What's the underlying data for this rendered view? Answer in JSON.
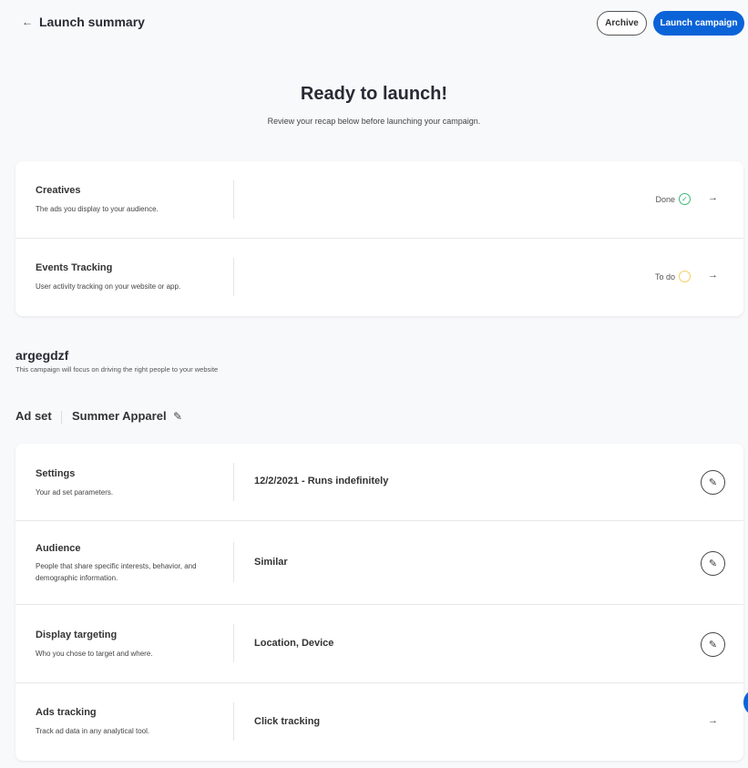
{
  "header": {
    "title": "Launch summary",
    "archive_label": "Archive",
    "launch_label": "Launch campaign"
  },
  "hero": {
    "title": "Ready to launch!",
    "subtitle": "Review your recap below before launching your campaign."
  },
  "checklist": [
    {
      "title": "Creatives",
      "desc": "The ads you display to your audience.",
      "status": "Done",
      "status_color": "#3cb878"
    },
    {
      "title": "Events Tracking",
      "desc": "User activity tracking on your website or app.",
      "status": "To do",
      "status_color": "#f5cf5a"
    }
  ],
  "campaign": {
    "name": "argegdzf",
    "desc": "This campaign will focus on driving the right people to your website"
  },
  "adset": {
    "label": "Ad set",
    "name": "Summer Apparel"
  },
  "adset_rows": [
    {
      "title": "Settings",
      "desc": "Your ad set parameters.",
      "value": "12/2/2021 - Runs indefinitely",
      "action": "edit"
    },
    {
      "title": "Audience",
      "desc": "People that share specific interests, behavior, and demographic information.",
      "value": "Similar",
      "action": "edit"
    },
    {
      "title": "Display targeting",
      "desc": "Who you chose to target and where.",
      "value": "Location, Device",
      "action": "edit"
    },
    {
      "title": "Ads tracking",
      "desc": "Track ad data in any analytical tool.",
      "value": "Click tracking",
      "action": "arrow"
    }
  ],
  "colors": {
    "accent": "#0b63d8"
  }
}
